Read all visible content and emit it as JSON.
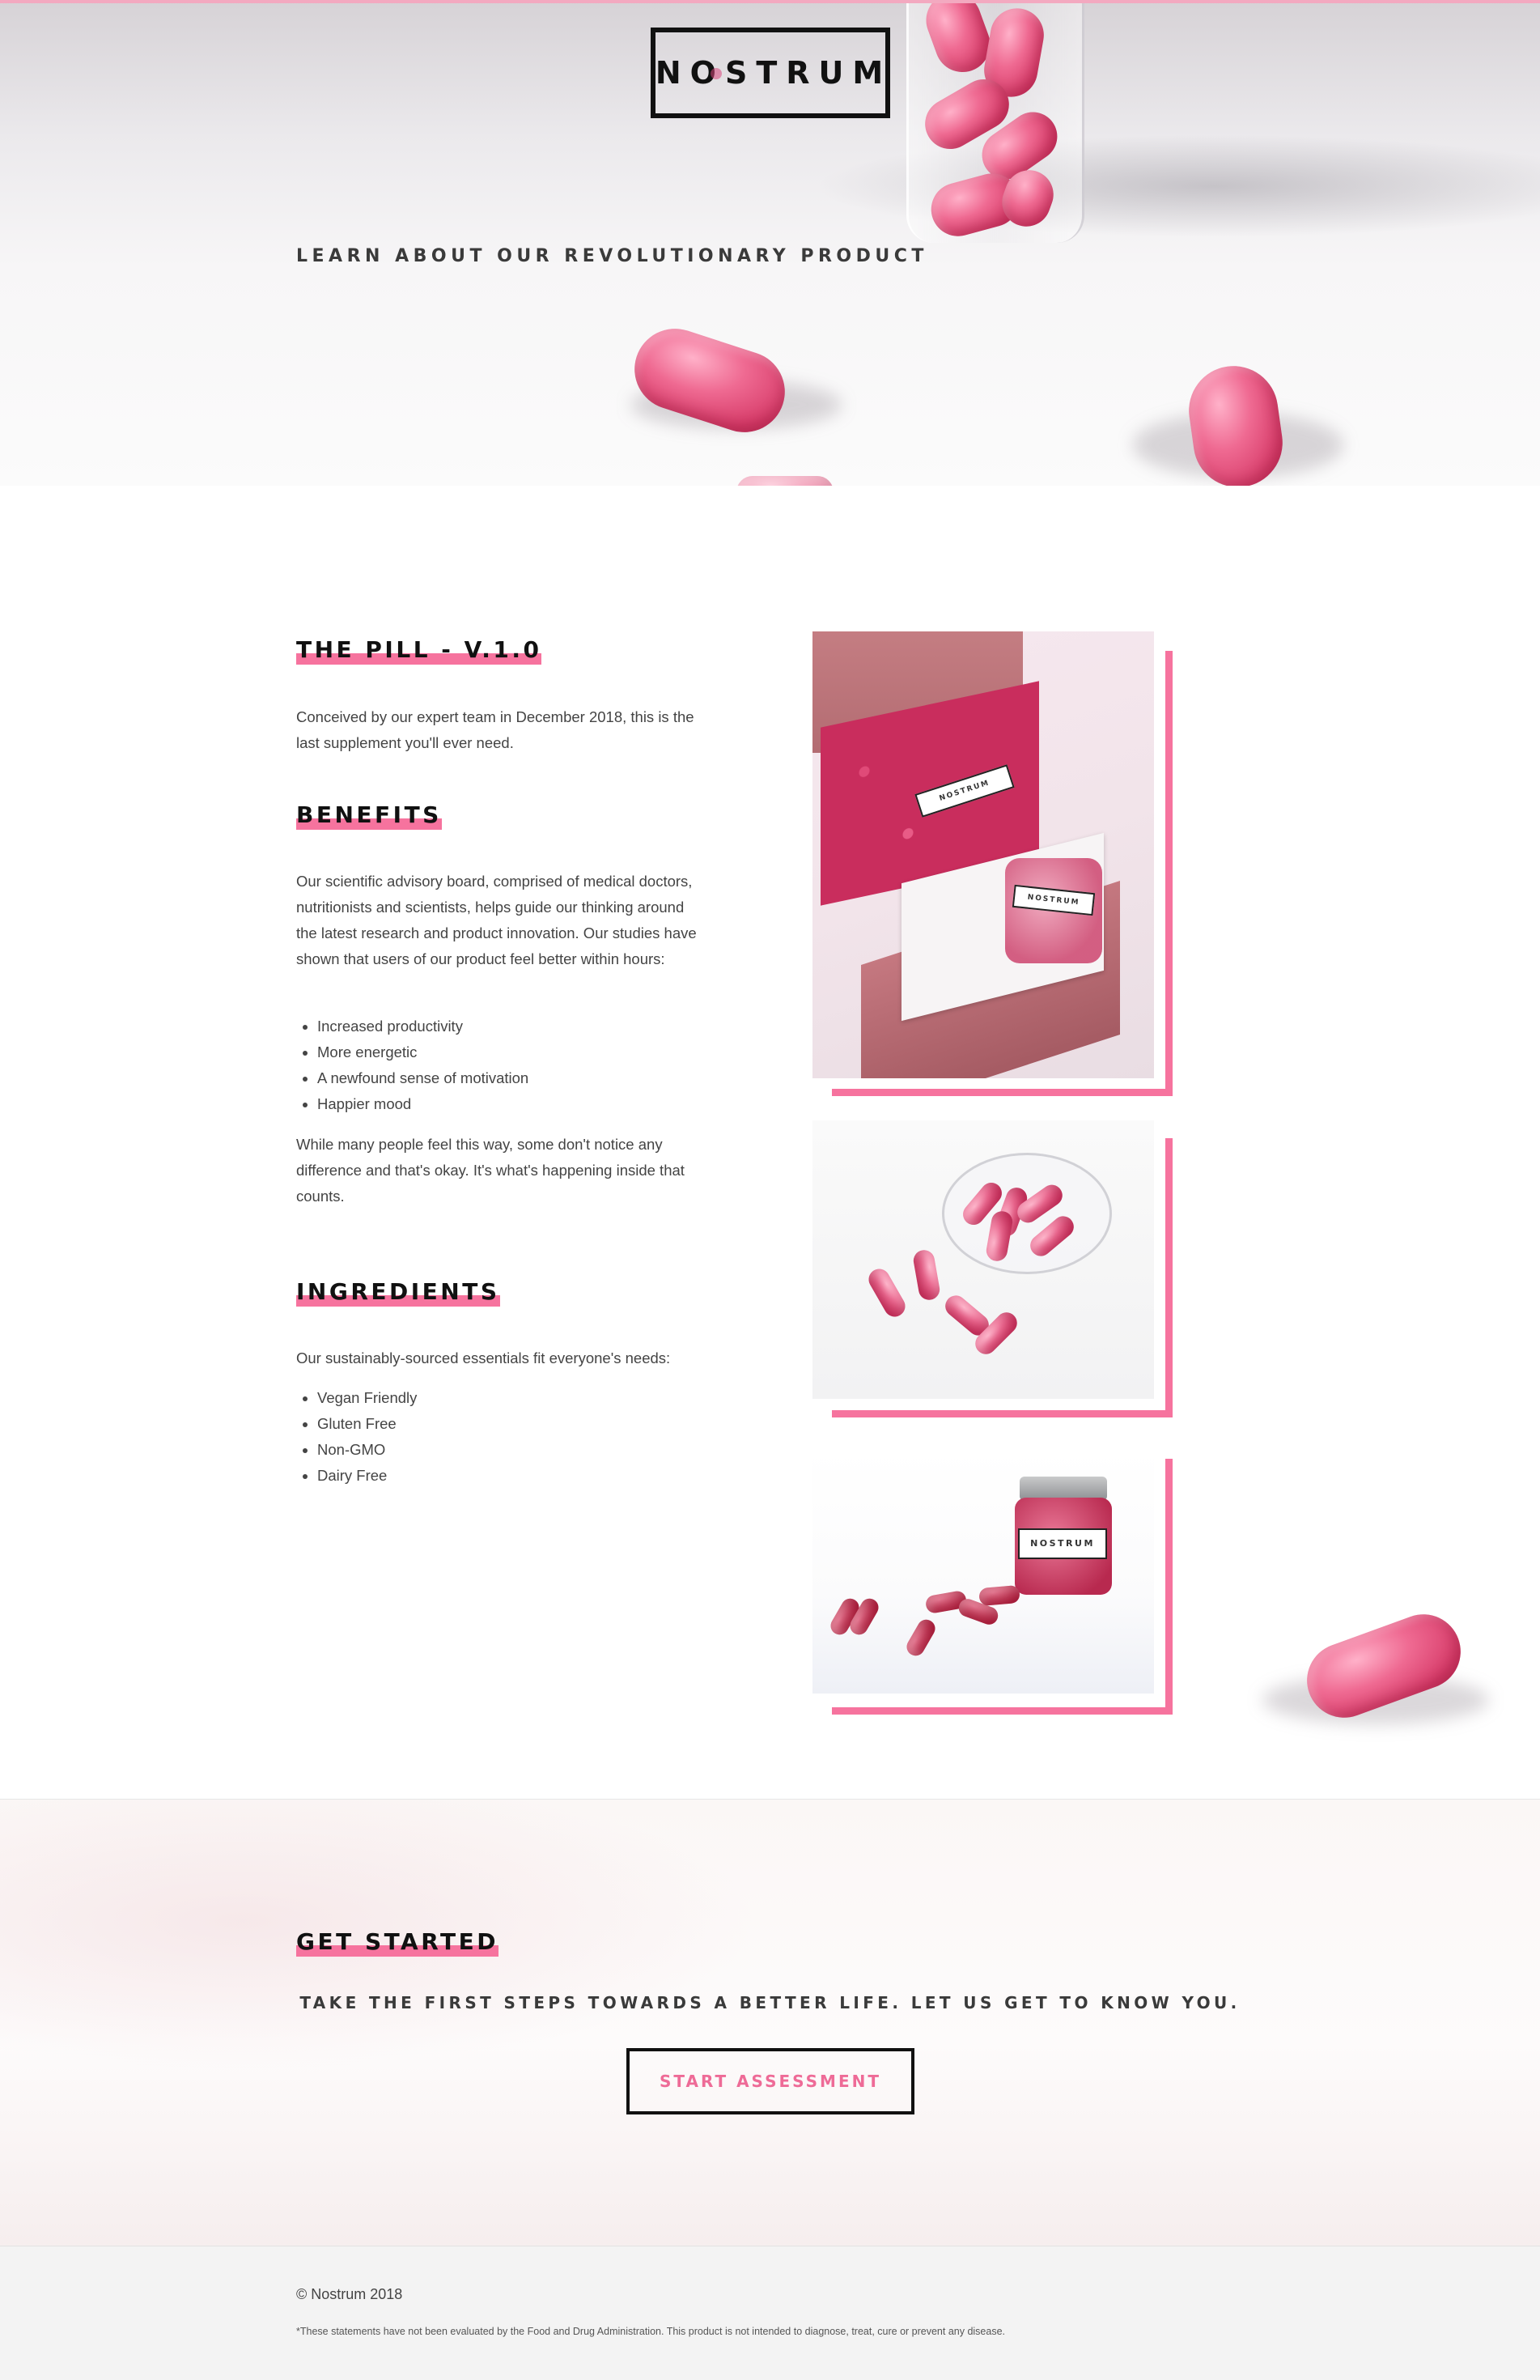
{
  "header": {
    "logo": "NOSTRUM",
    "tagline": "LEARN ABOUT OUR REVOLUTIONARY PRODUCT"
  },
  "pill_section": {
    "heading": "THE PILL - V.1.0",
    "intro": "Conceived by our expert team in December 2018, this is the last supplement you'll ever need."
  },
  "benefits": {
    "heading": "BENEFITS",
    "body": "Our scientific advisory board, comprised of medical doctors, nutritionists and scientists, helps guide our thinking around the latest research and product innovation. Our studies have shown that users of our product feel better within hours:",
    "items": [
      "Increased productivity",
      "More energetic",
      "A newfound sense of motivation",
      "Happier mood"
    ],
    "closing": "While many people feel this way, some don't notice any difference and that's okay. It's what's happening inside that counts."
  },
  "ingredients": {
    "heading": "INGREDIENTS",
    "body": "Our sustainably-sourced essentials fit everyone's needs:",
    "items": [
      "Vegan Friendly",
      "Gluten Free",
      "Non-GMO",
      "Dairy Free"
    ]
  },
  "get_started": {
    "heading": "GET STARTED",
    "subtitle": "TAKE THE FIRST STEPS TOWARDS A BETTER LIFE. LET US GET TO KNOW YOU.",
    "cta": "START ASSESSMENT"
  },
  "footer": {
    "copyright": "© Nostrum 2018",
    "disclaimer": "*These statements have not been evaluated by the Food and Drug Administration. This product is not intended to diagnose, treat, cure or prevent any disease."
  },
  "colors": {
    "accent_pink": "#f6739e",
    "cta_text": "#ee6b97",
    "text": "#444444",
    "footer_bg": "#f3f3f3"
  }
}
